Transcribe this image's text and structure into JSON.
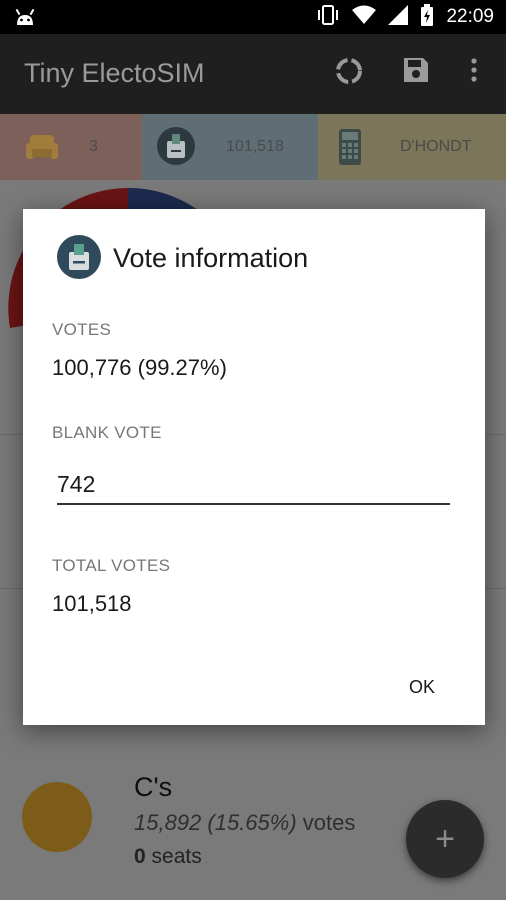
{
  "status_bar": {
    "time": "22:09"
  },
  "app_bar": {
    "title": "Tiny ElectoSIM"
  },
  "info_row": {
    "seats": "3",
    "votes": "101,518",
    "method": "D'HONDT"
  },
  "party": {
    "name": "C's",
    "votes_number": "15,892 (15.65%)",
    "votes_suffix": " votes",
    "seats_number": "0",
    "seats_suffix": " seats",
    "color": "#e0a800"
  },
  "fab": {
    "label": "+"
  },
  "dialog": {
    "title": "Vote information",
    "votes_label": "VOTES",
    "votes_value": "100,776 (99.27%)",
    "blank_label": "BLANK VOTE",
    "blank_value": "742",
    "total_label": "TOTAL VOTES",
    "total_value": "101,518",
    "ok_label": "OK"
  }
}
